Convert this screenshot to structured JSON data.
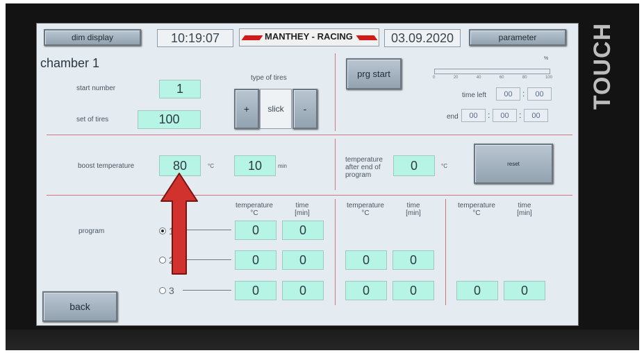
{
  "header": {
    "dim_display": "dim display",
    "time": "10:19:07",
    "logo_text": "MANTHEY - RACING",
    "date": "03.09.2020",
    "parameter": "parameter"
  },
  "brand": "TOUCH",
  "chamber": {
    "title": "chamber 1",
    "start_number_label": "start number",
    "start_number": "1",
    "set_of_tires_label": "set of tires",
    "set_of_tires": "100",
    "type_of_tires_label": "type of tires",
    "plus": "+",
    "tire_type": "slick",
    "minus": "-"
  },
  "run": {
    "prg_start": "prg start",
    "percent_sign": "%",
    "progress_ticks": [
      "0",
      "20",
      "40",
      "60",
      "80",
      "100"
    ],
    "time_left_label": "time left",
    "time_left": [
      "00",
      "00"
    ],
    "end_label": "end",
    "end": [
      "00",
      "00",
      "00"
    ],
    "colon": ":"
  },
  "boost": {
    "label": "boost temperature",
    "temperature": "80",
    "temp_unit": "°C",
    "minutes": "10",
    "min_unit": "min",
    "after_end_label": "temperature after end of program",
    "after_end_temp": "0",
    "after_end_unit": "°C",
    "reset": "reset"
  },
  "program": {
    "label": "program",
    "header_temperature": "temperature",
    "header_temp_unit": "°C",
    "header_time": "time",
    "header_time_unit": "[min]",
    "options": [
      "1",
      "2",
      "3"
    ],
    "selected_option": "1",
    "rows": [
      {
        "steps": [
          [
            "0",
            "0"
          ]
        ]
      },
      {
        "steps": [
          [
            "0",
            "0"
          ],
          [
            "0",
            "0"
          ]
        ]
      },
      {
        "steps": [
          [
            "0",
            "0"
          ],
          [
            "0",
            "0"
          ],
          [
            "0",
            "0"
          ]
        ]
      }
    ]
  },
  "back": "back"
}
